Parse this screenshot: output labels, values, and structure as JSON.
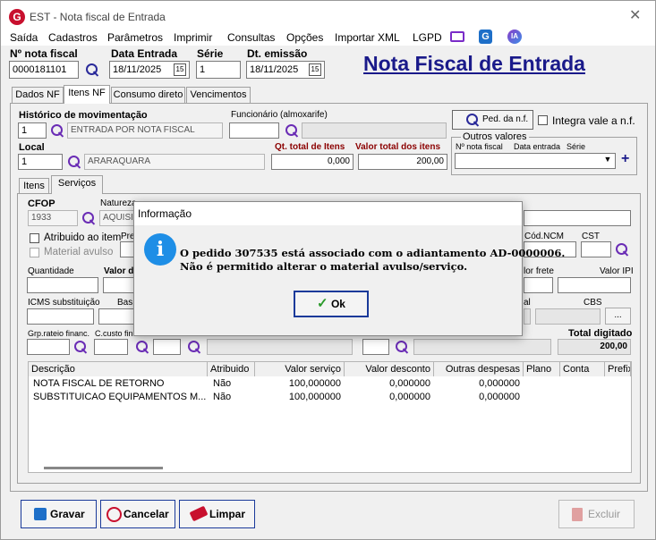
{
  "window": {
    "title": "EST - Nota fiscal de Entrada",
    "close": "✕"
  },
  "menu": [
    "Saída",
    "Cadastros",
    "Parâmetros",
    "Imprimir",
    "Consultas",
    "Opções",
    "Importar XML",
    "LGPD"
  ],
  "menu_icons": {
    "ia": "IA",
    "g": "G"
  },
  "header": {
    "nf_label": "Nº nota fiscal",
    "nf_value": "0000181101",
    "data_entrada_label": "Data Entrada",
    "data_entrada_value": "18/11/2025",
    "serie_label": "Série",
    "serie_value": "1",
    "dt_emissao_label": "Dt. emissão",
    "dt_emissao_value": "18/11/2025",
    "cal_label": "15",
    "page_title": "Nota Fiscal de Entrada"
  },
  "tabs": [
    "Dados NF",
    "Itens NF",
    "Consumo direto",
    "Vencimentos"
  ],
  "itens": {
    "historico_label": "Histórico de movimentação",
    "historico_code": "1",
    "historico_desc": "ENTRADA POR NOTA FISCAL",
    "funcionario_label": "Funcionário (almoxarife)",
    "ped_button": "Ped. da n.f.",
    "integra_label": "Integra vale a n.f.",
    "local_label": "Local",
    "local_code": "1",
    "local_desc": "ARARAQUARA",
    "qt_total_label": "Qt. total de Itens",
    "qt_total_value": "0,000",
    "valor_total_label": "Valor total dos itens",
    "valor_total_value": "200,00",
    "outros_valores_label": "Outros valores",
    "nf_col": "Nº nota fiscal",
    "data_col": "Data entrada",
    "serie_col": "Série",
    "plus": "+"
  },
  "subtabs": [
    "Itens",
    "Serviços"
  ],
  "servicos": {
    "cfop_label": "CFOP",
    "cfop_value": "1933",
    "natureza_label": "Natureza",
    "natureza_value": "AQUISIÇ",
    "atribuido_label": "Atribuido ao item",
    "material_avulso_label": "Material avulso",
    "pre_label": "Pre",
    "cod_ncm_label": "Cód.NCM",
    "cst_label": "CST",
    "quantidade_label": "Quantidade",
    "valor_label": "Valor d",
    "valor_frete_label": "lor frete",
    "valor_ipi_label": "Valor IPI",
    "icms_label": "ICMS substituição",
    "base_label": "Bas",
    "al_label": "al",
    "cbs_label": "CBS",
    "ellipsis": "...",
    "grp_label": "Grp.rateio financ.",
    "ccusto_label": "C.custo fin",
    "total_digitado_label": "Total digitado",
    "total_digitado_value": "200,00"
  },
  "grid": {
    "headers": [
      "Descrição",
      "Atribuido",
      "Valor serviço",
      "Valor desconto",
      "Outras despesas",
      "Plano",
      "Conta",
      "Prefix"
    ],
    "rows": [
      [
        "NOTA FISCAL DE RETORNO",
        "Não",
        "100,000000",
        "0,000000",
        "0,000000"
      ],
      [
        "SUBSTITUICAO EQUIPAMENTOS M...",
        "Não",
        "100,000000",
        "0,000000",
        "0,000000"
      ]
    ]
  },
  "buttons": {
    "gravar": "Gravar",
    "cancelar": "Cancelar",
    "limpar": "Limpar",
    "excluir": "Excluir"
  },
  "dialog": {
    "title": "Informação",
    "line1": "O pedido 307535 está associado com o adiantamento AD-0000006.",
    "line2": "Não é permitido alterar o material avulso/serviço.",
    "ok": "Ok"
  },
  "colors": {
    "title_blue": "#1a1a8a",
    "red_label": "#8b0000",
    "info_blue": "#1e8ee6",
    "icon_purple": "#6a2cb5"
  }
}
